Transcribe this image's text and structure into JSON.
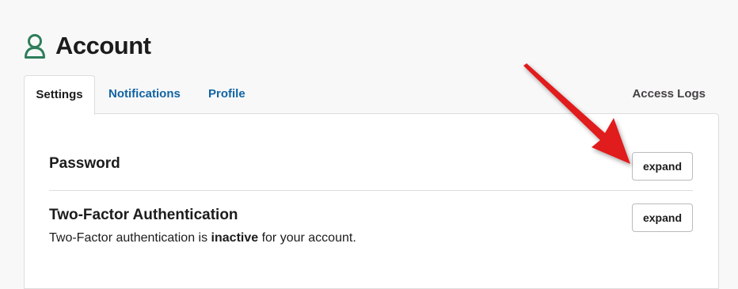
{
  "header": {
    "title": "Account",
    "icon": "user-icon",
    "accent": "#2e7d5b"
  },
  "tabs": [
    {
      "label": "Settings",
      "active": true
    },
    {
      "label": "Notifications",
      "active": false
    },
    {
      "label": "Profile",
      "active": false
    },
    {
      "label": "Access Logs",
      "active": false
    }
  ],
  "sections": {
    "password": {
      "title": "Password",
      "button": "expand"
    },
    "two_factor": {
      "title": "Two-Factor Authentication",
      "button": "expand",
      "desc_before": "Two-Factor authentication is ",
      "desc_status": "inactive",
      "desc_after": " for your account."
    }
  },
  "colors": {
    "link": "#1264a3",
    "annotation_arrow": "#e01e1e"
  }
}
